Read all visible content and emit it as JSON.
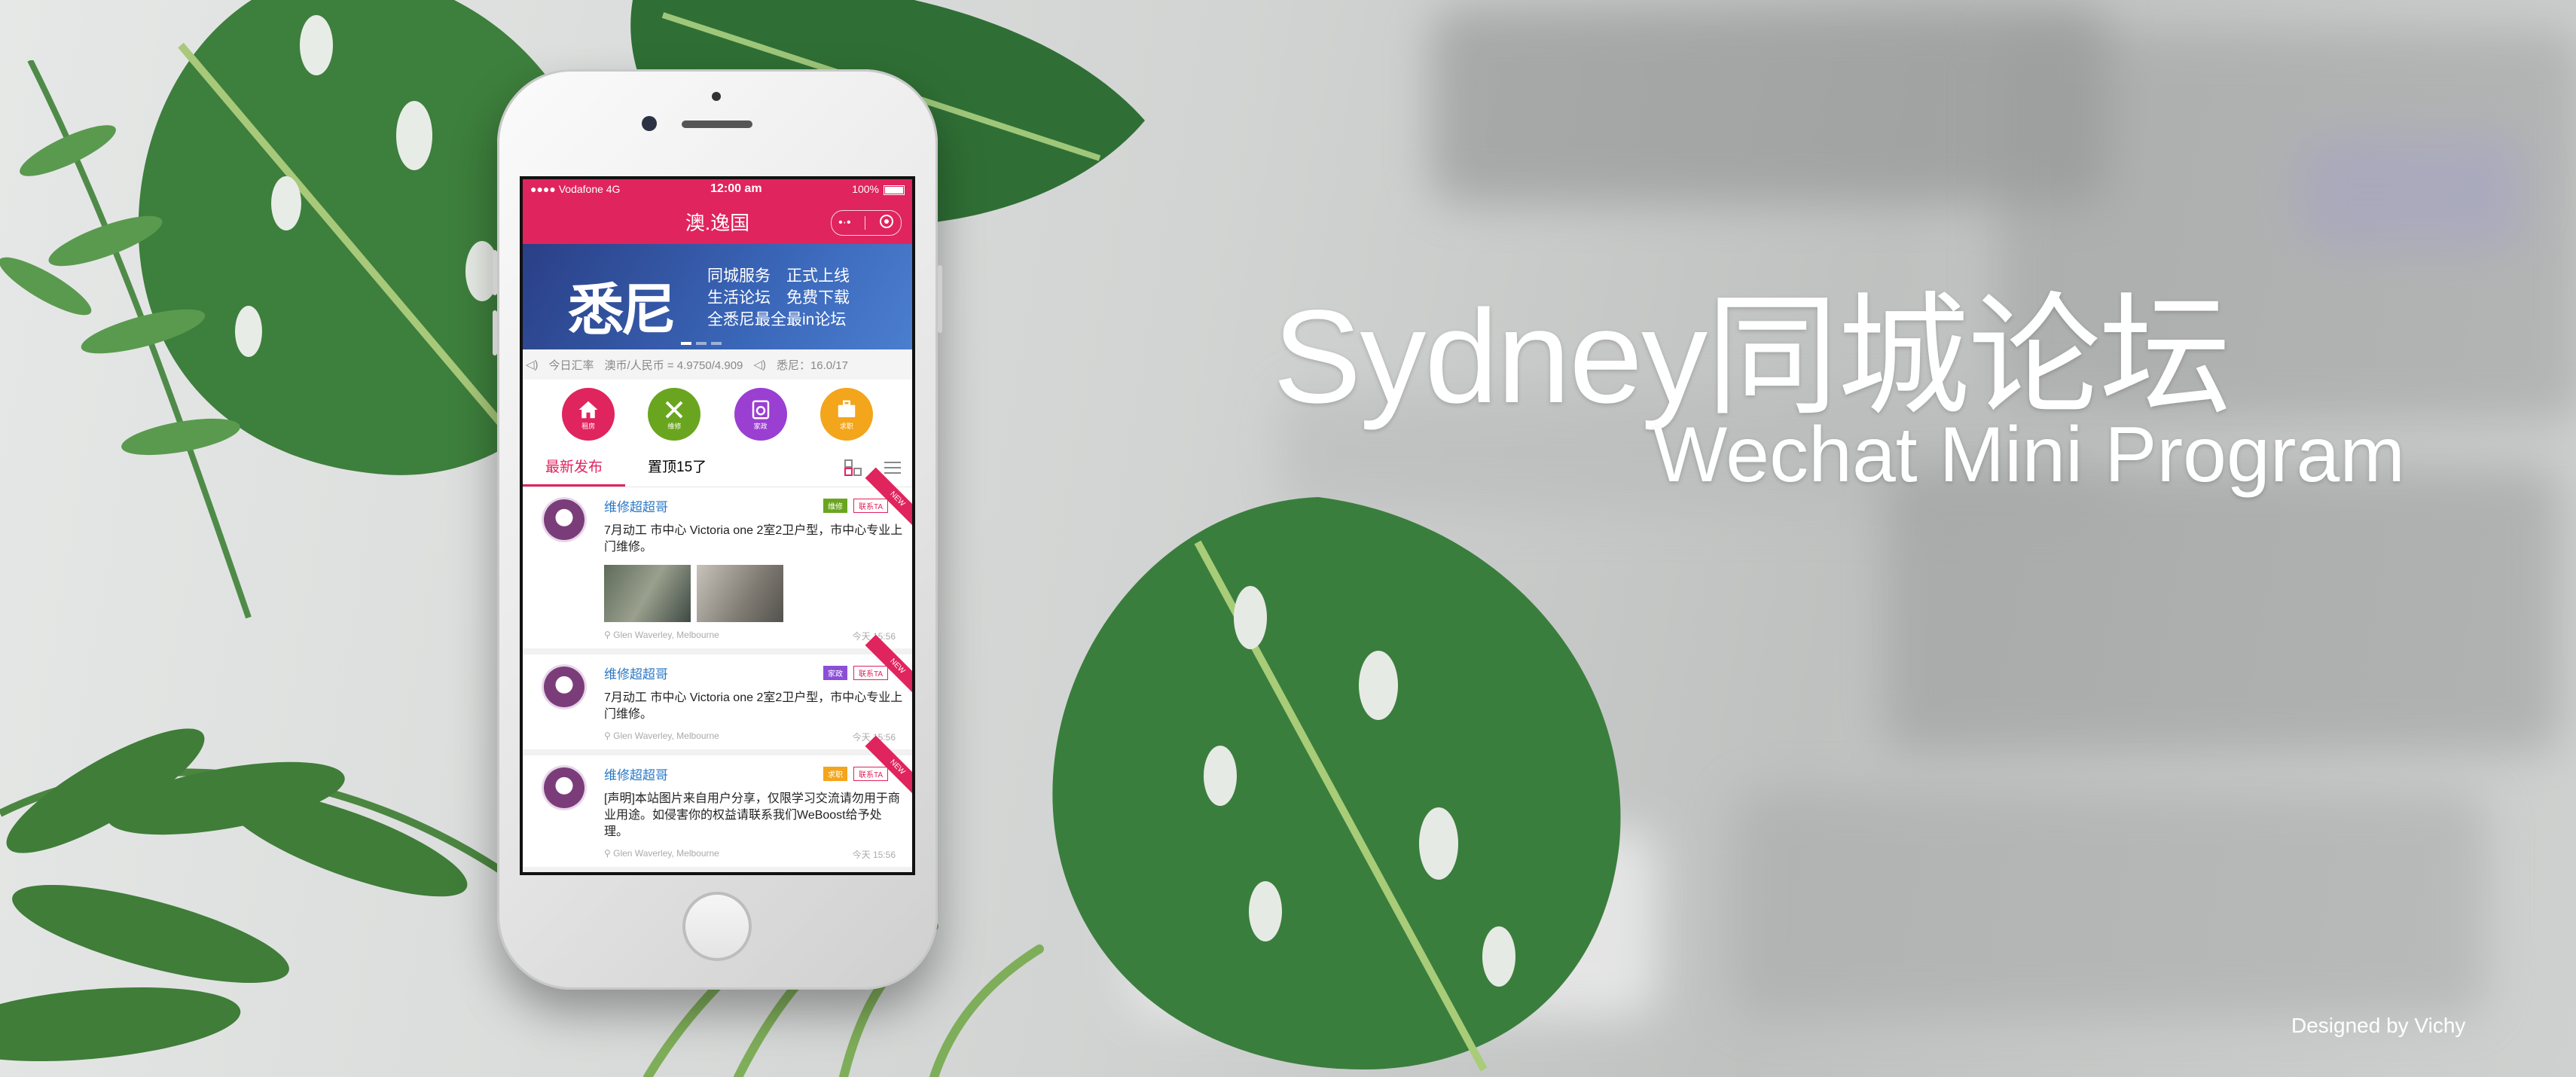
{
  "headline": {
    "title": "Sydney同城论坛",
    "subtitle": "Wechat Mini Program"
  },
  "credit": "Designed by Vichy",
  "phone": {
    "status": {
      "carrier": "●●●● Vodafone 4G",
      "time": "12:00 am",
      "battery": "100%"
    },
    "nav": {
      "title": "澳.逸国",
      "more_icon": "more-dots-icon",
      "close_icon": "close-circle-icon"
    },
    "banner": {
      "big": "悉尼",
      "line1": "同城服务　正式上线",
      "line2": "生活论坛　免费下载",
      "line3": "全悉尼最全最in论坛"
    },
    "ticker": {
      "exchange": "今日汇率",
      "rate": "澳币/人民币 = 4.9750/4.909",
      "weather": "悉尼：16.0/17"
    },
    "quick_items": [
      {
        "label": "租房",
        "color": "#e0245e",
        "icon": "home-icon"
      },
      {
        "label": "维修",
        "color": "#6aa51f",
        "icon": "tools-icon"
      },
      {
        "label": "家政",
        "color": "#9a3fd2",
        "icon": "washer-icon"
      },
      {
        "label": "求职",
        "color": "#f3a51c",
        "icon": "briefcase-icon"
      }
    ],
    "tabs": [
      {
        "label": "最新发布",
        "active": true
      },
      {
        "label": "置顶15了",
        "active": false
      }
    ],
    "posts": [
      {
        "user": "维修超超哥",
        "tag": "维修",
        "tag_color": "#6aa51f",
        "tag2": "联系TA",
        "text": "7月动工 市中心 Victoria one 2室2卫户型，市中心专业上门维修。",
        "has_photos": true,
        "location": "Glen Waverley, Melbourne",
        "time": "今天 15:56",
        "ribbon": "NEW"
      },
      {
        "user": "维修超超哥",
        "tag": "家政",
        "tag_color": "#8b4fd6",
        "tag2": "联系TA",
        "text": "7月动工 市中心 Victoria one 2室2卫户型，市中心专业上门维修。",
        "has_photos": false,
        "location": "Glen Waverley, Melbourne",
        "time": "今天 15:56",
        "ribbon": "NEW"
      },
      {
        "user": "维修超超哥",
        "tag": "求职",
        "tag_color": "#f3a51c",
        "tag2": "联系TA",
        "text": "[声明]本站图片来自用户分享，仅限学习交流请勿用于商业用途。如侵害你的权益请联系我们WeBoost给予处理。",
        "has_photos": false,
        "location": "Glen Waverley, Melbourne",
        "time": "今天 15:56",
        "ribbon": "NEW"
      }
    ]
  }
}
